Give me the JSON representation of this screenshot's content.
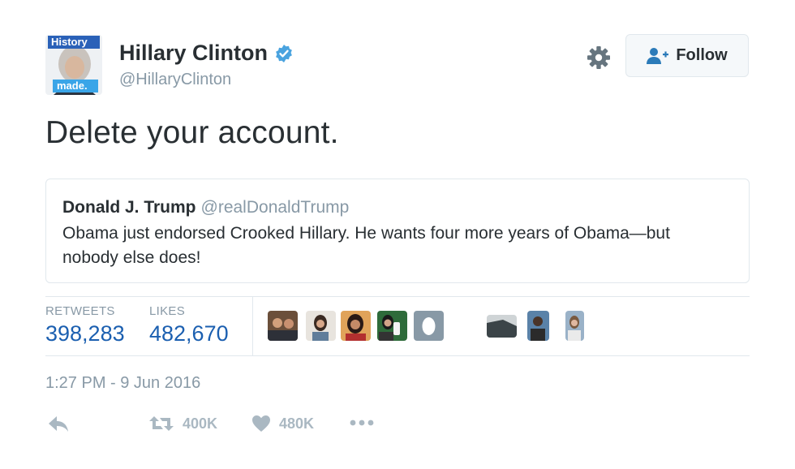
{
  "author": {
    "name": "Hillary Clinton",
    "handle": "@HillaryClinton",
    "avatar_text_top": "History",
    "avatar_text_bottom": "made."
  },
  "follow_button": {
    "label": "Follow"
  },
  "tweet": {
    "text": "Delete your account."
  },
  "quoted_tweet": {
    "name": "Donald J. Trump",
    "handle": "@realDonaldTrump",
    "text": "Obama just endorsed Crooked Hillary. He wants four more years of Obama—but nobody else does!"
  },
  "stats": {
    "retweets_label": "RETWEETS",
    "retweets_value": "398,283",
    "likes_label": "LIKES",
    "likes_value": "482,670"
  },
  "timestamp": "1:27 PM - 9 Jun 2016",
  "actions": {
    "retweet_count": "400K",
    "like_count": "480K"
  },
  "colors": {
    "verified": "#4aa3df",
    "stat_value": "#1b5fb0",
    "muted": "#8899a6",
    "action": "#aab8c2"
  }
}
